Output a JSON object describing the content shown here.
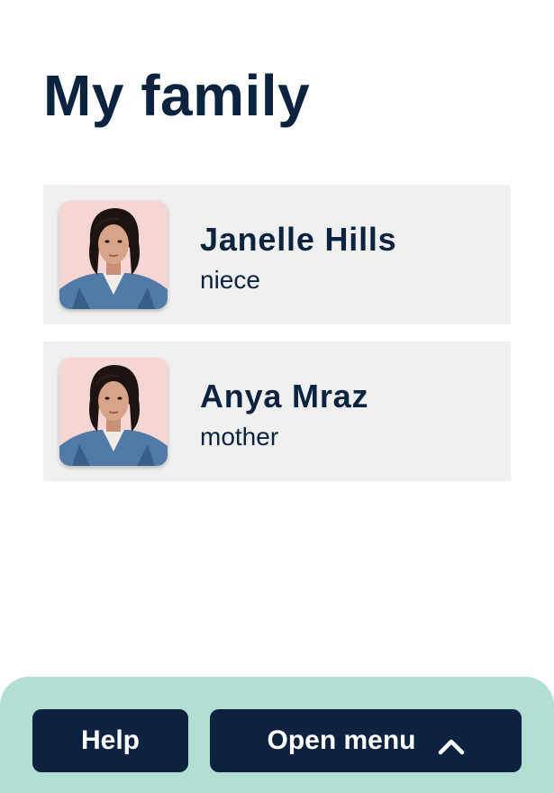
{
  "page": {
    "title": "My family"
  },
  "members": [
    {
      "name": "Janelle Hills",
      "relation": "niece",
      "avatar": "portrait-photo"
    },
    {
      "name": "Anya Mraz",
      "relation": "mother",
      "avatar": "portrait-photo"
    }
  ],
  "footer": {
    "help_label": "Help",
    "menu_label": "Open menu",
    "menu_icon": "chevron-up-icon"
  },
  "colors": {
    "primary": "#0c2340",
    "card_bg": "#f0f0f0",
    "footer_bg": "#b2ded4",
    "text_on_primary": "#ffffff"
  }
}
